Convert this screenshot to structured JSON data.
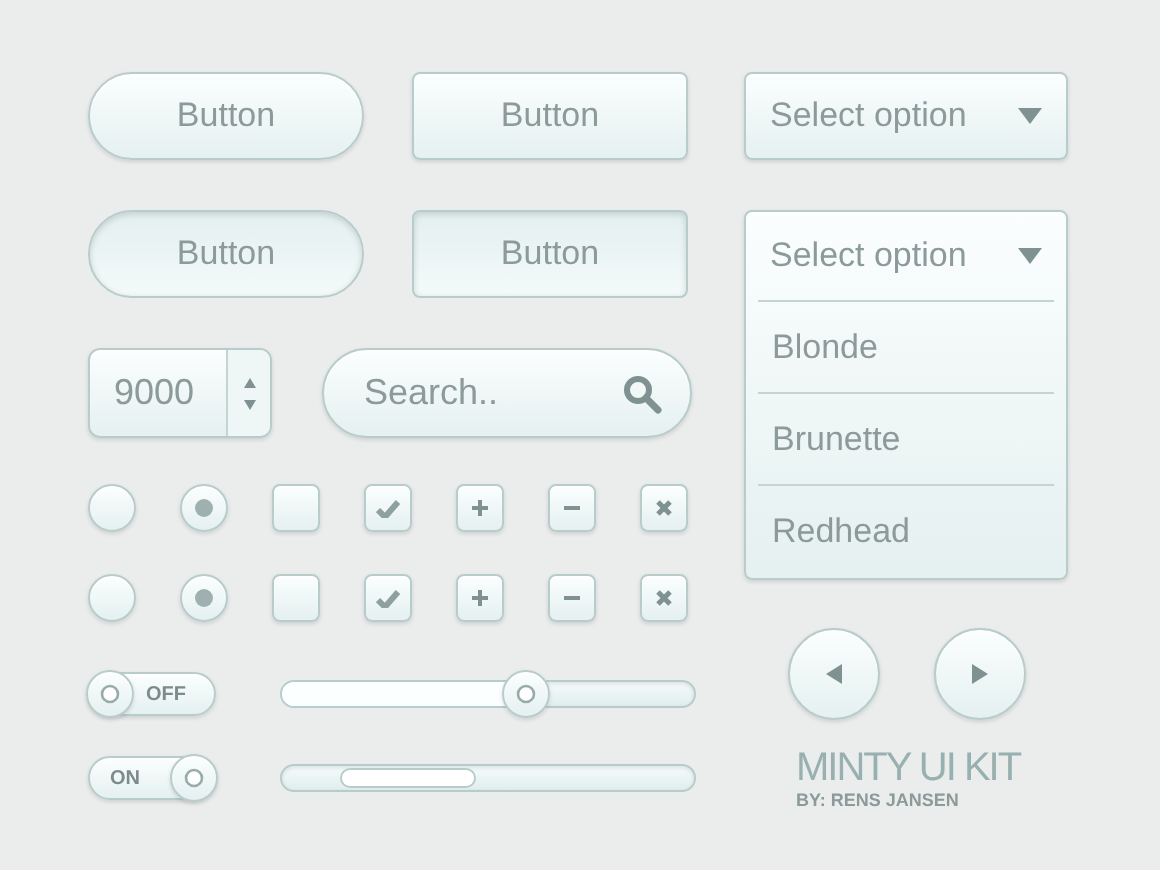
{
  "buttons": [
    {
      "label": "Button",
      "kind": "pill",
      "pressed": false
    },
    {
      "label": "Button",
      "kind": "rect",
      "pressed": false
    },
    {
      "label": "Button",
      "kind": "pill",
      "pressed": true
    },
    {
      "label": "Button",
      "kind": "rect",
      "pressed": true
    }
  ],
  "select_closed": {
    "label": "Select option",
    "expanded": false
  },
  "select_open": {
    "label": "Select option",
    "expanded": true,
    "options": [
      {
        "label": "Blonde",
        "selected": false
      },
      {
        "label": "Brunette",
        "selected": false
      },
      {
        "label": "Redhead",
        "selected": false
      }
    ]
  },
  "spinner": {
    "value": "9000"
  },
  "search": {
    "placeholder": "Search.."
  },
  "control_rows": [
    {
      "items": [
        {
          "kind": "radio",
          "checked": false
        },
        {
          "kind": "radio",
          "checked": true
        },
        {
          "kind": "checkbox",
          "checked": false
        },
        {
          "kind": "checkbox",
          "checked": true
        },
        {
          "kind": "plus"
        },
        {
          "kind": "minus"
        },
        {
          "kind": "close"
        }
      ]
    },
    {
      "items": [
        {
          "kind": "radio",
          "checked": false
        },
        {
          "kind": "radio",
          "checked": true
        },
        {
          "kind": "checkbox",
          "checked": false
        },
        {
          "kind": "checkbox",
          "checked": true
        },
        {
          "kind": "plus"
        },
        {
          "kind": "minus"
        },
        {
          "kind": "close"
        }
      ]
    }
  ],
  "switch_rows": [
    {
      "toggle": {
        "label": "OFF",
        "on": false
      },
      "slider": {
        "kind": "slider",
        "level": 0.59
      }
    },
    {
      "toggle": {
        "label": "ON",
        "on": true
      },
      "slider": {
        "kind": "scrollbar"
      }
    }
  ],
  "nav_buttons": [
    {
      "kind": "previous"
    },
    {
      "kind": "next"
    }
  ],
  "logo": {
    "title": "MINTY UI KIT",
    "byline": "BY: RENS JANSEN"
  }
}
